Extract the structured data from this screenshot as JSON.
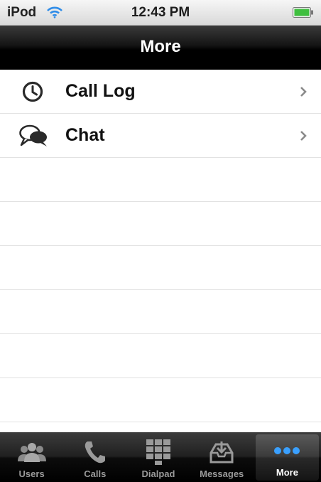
{
  "status_bar": {
    "carrier": "iPod",
    "time": "12:43 PM"
  },
  "nav": {
    "title": "More"
  },
  "menu": {
    "items": [
      {
        "label": "Call Log",
        "icon": "clock-icon"
      },
      {
        "label": "Chat",
        "icon": "chat-bubbles-icon"
      }
    ]
  },
  "tab_bar": {
    "active": "More",
    "tabs": [
      {
        "label": "Users",
        "icon": "users-icon"
      },
      {
        "label": "Calls",
        "icon": "phone-icon"
      },
      {
        "label": "Dialpad",
        "icon": "dialpad-icon"
      },
      {
        "label": "Messages",
        "icon": "inbox-icon"
      },
      {
        "label": "More",
        "icon": "more-dots-icon"
      }
    ]
  },
  "colors": {
    "nav_bar": "#000000",
    "tab_bar": "#1a1a1a",
    "more_dots": "#3aa0ff",
    "wifi": "#2f8ce8",
    "battery": "#3fbf3f"
  }
}
